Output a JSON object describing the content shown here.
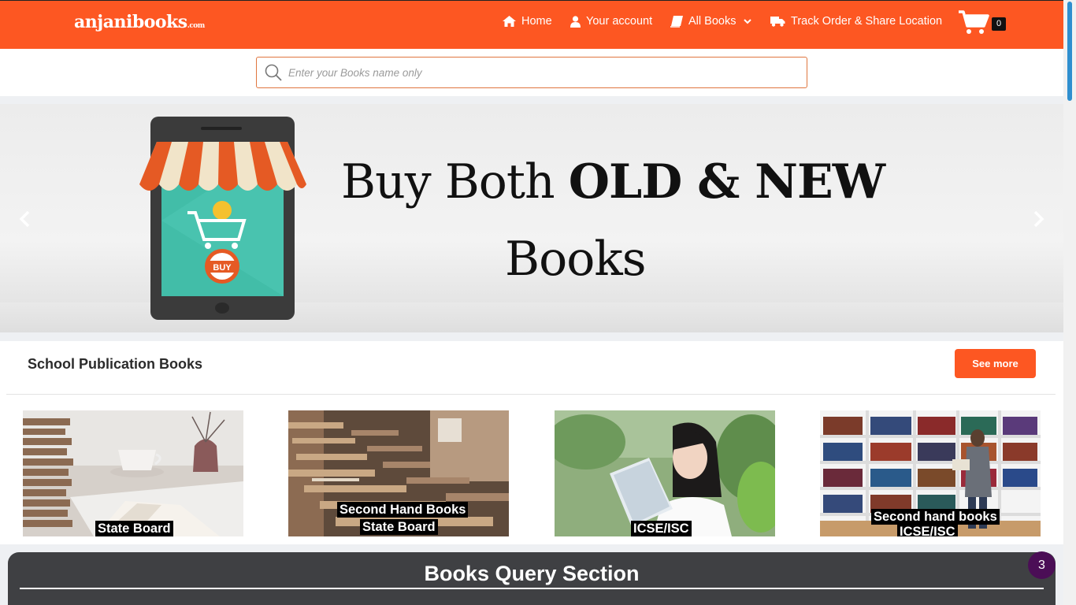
{
  "header": {
    "logo_main": "anjanibooks",
    "logo_suffix": ".com",
    "nav": {
      "home": "Home",
      "account": "Your account",
      "all_books": "All Books",
      "track": "Track Order & Share Location"
    },
    "cart_count": "0"
  },
  "search": {
    "placeholder": "Enter your Books name only"
  },
  "banner": {
    "line1_regular": "Buy Both ",
    "line1_bold": "OLD & NEW",
    "line2": "Books",
    "sign_text": "BUY"
  },
  "section": {
    "title": "School Publication Books",
    "see_more": "See more",
    "cards": [
      {
        "label_1": "State Board",
        "label_2": ""
      },
      {
        "label_1": "Second Hand Books",
        "label_2": "State Board"
      },
      {
        "label_1": "ICSE/ISC",
        "label_2": ""
      },
      {
        "label_1": "Second hand books",
        "label_2": "ICSE/ISC"
      }
    ]
  },
  "query": {
    "title": "Books Query Section"
  },
  "notification_count": "3",
  "colors": {
    "brand_orange": "#fd5722",
    "query_bg": "#3f4043",
    "badge_purple": "#4b0e56"
  }
}
